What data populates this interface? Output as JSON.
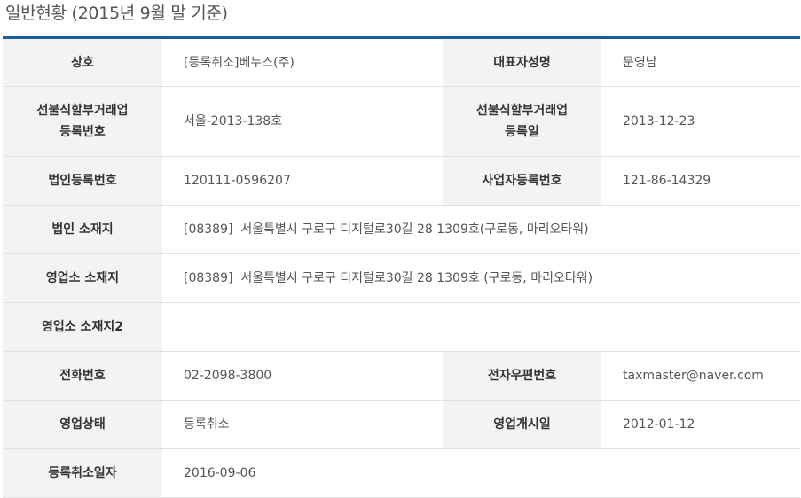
{
  "title": "일반현황 (2015년 9월 말 기준)",
  "rows": {
    "trade_name": {
      "label": "상호",
      "value": "[등록취소]베누스(주)"
    },
    "ceo_name": {
      "label": "대표자성명",
      "value": "문영남"
    },
    "reg_no": {
      "label_line1": "선불식할부거래업",
      "label_line2": "등록번호",
      "value": "서울-2013-138호"
    },
    "reg_date": {
      "label_line1": "선불식할부거래업",
      "label_line2": "등록일",
      "value": "2013-12-23"
    },
    "corp_reg_no": {
      "label": "법인등록번호",
      "value": "120111-0596207"
    },
    "biz_reg_no": {
      "label": "사업자등록번호",
      "value": "121-86-14329"
    },
    "corp_address": {
      "label": "법인 소재지",
      "value": "[08389]  서울특별시 구로구 디지털로30길 28 1309호(구로동, 마리오타워)"
    },
    "office_address": {
      "label": "영업소 소재지",
      "value": "[08389]  서울특별시 구로구 디지털로30길 28 1309호 (구로동, 마리오타워)"
    },
    "office_address2": {
      "label": "영업소 소재지2",
      "value": ""
    },
    "phone": {
      "label": "전화번호",
      "value": "02-2098-3800"
    },
    "email": {
      "label": "전자우편번호",
      "value": "taxmaster@naver.com"
    },
    "status": {
      "label": "영업상태",
      "value": "등록취소"
    },
    "open_date": {
      "label": "영업개시일",
      "value": "2012-01-12"
    },
    "cancel_date": {
      "label": "등록취소일자",
      "value": "2016-09-06"
    }
  }
}
